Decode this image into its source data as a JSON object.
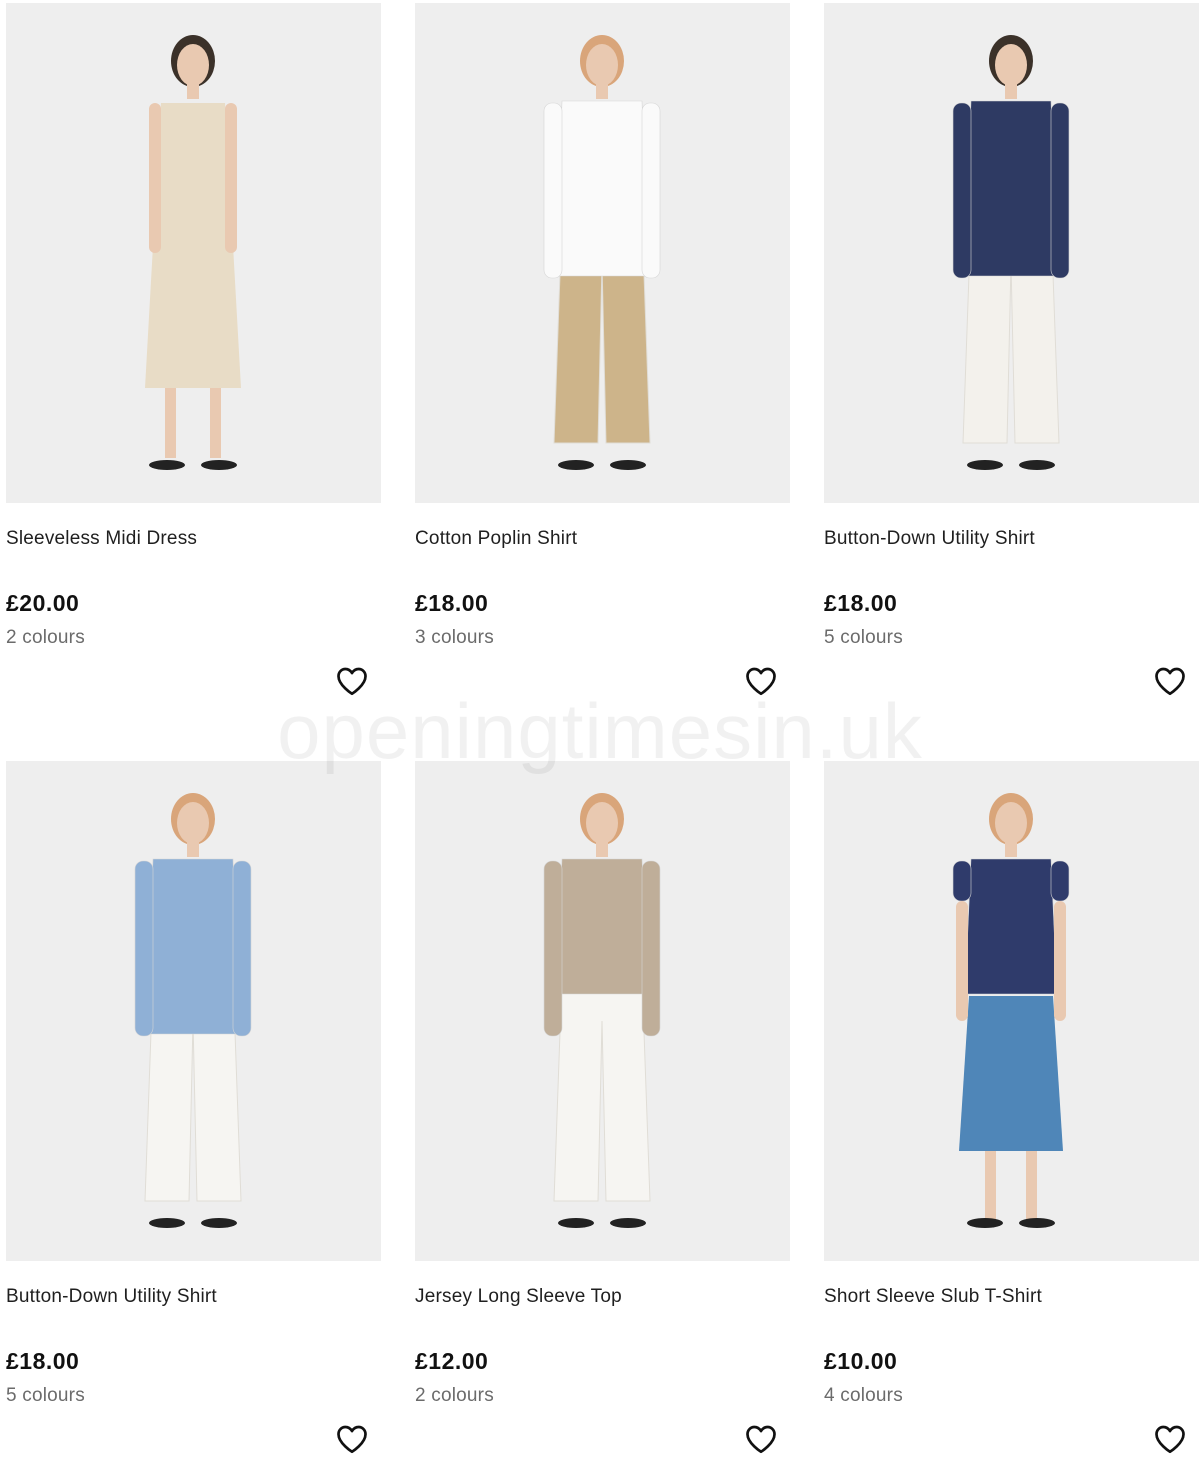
{
  "products": [
    {
      "name": "Sleeveless Midi Dress",
      "price": "£20.00",
      "colours": "2 colours",
      "image": "model-sleeveless-midi-dress",
      "garment_color": "#e8dcc6",
      "bottom_color": "#e8dcc6",
      "hair_color": "#3b3129"
    },
    {
      "name": "Cotton Poplin Shirt",
      "price": "£18.00",
      "colours": "3 colours",
      "image": "model-cotton-poplin-shirt",
      "garment_color": "#fafafa",
      "bottom_color": "#cdb48a",
      "hair_color": "#d9a57a"
    },
    {
      "name": "Button-Down Utility Shirt",
      "price": "£18.00",
      "colours": "5 colours",
      "image": "model-navy-utility-shirt",
      "garment_color": "#2e3a63",
      "bottom_color": "#f3f1ec",
      "hair_color": "#3b3129"
    },
    {
      "name": "Button-Down Utility Shirt",
      "price": "£18.00",
      "colours": "5 colours",
      "image": "model-blue-utility-shirt",
      "garment_color": "#8fb0d6",
      "bottom_color": "#f6f5f2",
      "hair_color": "#d9a57a"
    },
    {
      "name": "Jersey Long Sleeve Top",
      "price": "£12.00",
      "colours": "2 colours",
      "image": "model-jersey-long-sleeve-top",
      "garment_color": "#bfae99",
      "bottom_color": "#f6f5f2",
      "hair_color": "#d9a57a"
    },
    {
      "name": "Short Sleeve Slub T-Shirt",
      "price": "£10.00",
      "colours": "4 colours",
      "image": "model-slub-t-shirt",
      "garment_color": "#2f3b6b",
      "bottom_color": "#4f86b8",
      "hair_color": "#d9a57a"
    }
  ],
  "icons": {
    "wishlist": "heart-outline-icon"
  },
  "watermark": "openingtimesin.uk"
}
